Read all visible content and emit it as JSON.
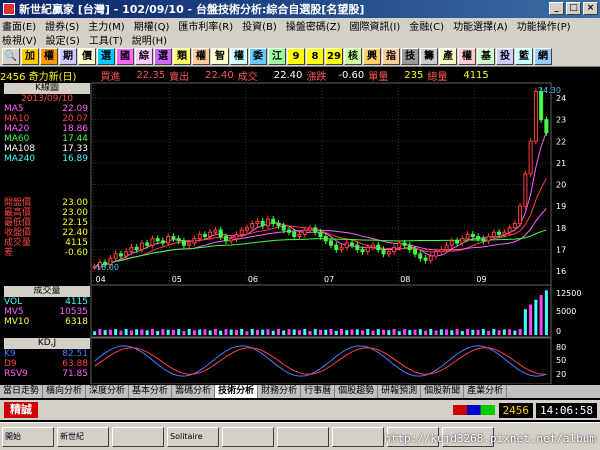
{
  "window": {
    "title": "新世紀贏家 [台灣] - 102/09/10 - 台盤技術分析:綜合自選股[名望股]"
  },
  "menu": {
    "row1": [
      "畫面(E)",
      "證券(S)",
      "主力(M)",
      "期權(Q)",
      "匯市利率(R)",
      "投資(B)",
      "操盤密碼(Z)",
      "國際資訊(I)",
      "金融(C)",
      "功能選擇(A)",
      "功能操作(P)"
    ],
    "row2": [
      "檢視(V)",
      "設定(S)",
      "工具(T)",
      "說明(H)"
    ]
  },
  "toolbar": {
    "buttons": [
      "加",
      "權",
      "期",
      "價",
      "選",
      "國",
      "綜",
      "選",
      "類",
      "權",
      "智",
      "權",
      "委",
      "江",
      "9",
      "8",
      "29",
      "核",
      "興",
      "指",
      "技",
      "籌",
      "產",
      "權",
      "基",
      "投",
      "籃",
      "網"
    ]
  },
  "quote": {
    "code_name": "2456 奇力新(日)",
    "buy_label": "買進",
    "buy": "22.35",
    "sell_label": "賣出",
    "sell": "22.40",
    "deal_label": "成交",
    "deal": "22.40",
    "change_label": "漲跌",
    "change": "-0.60",
    "single_label": "單量",
    "single": "235",
    "total_label": "總量",
    "total": "4115"
  },
  "kpanel": {
    "title": "K線圖",
    "date": "2013/09/10",
    "ma": [
      {
        "name": "MA5",
        "value": "22.09",
        "color": "#ff60ff"
      },
      {
        "name": "MA10",
        "value": "20.07",
        "color": "#ff4040"
      },
      {
        "name": "MA20",
        "value": "18.86",
        "color": "#ff60ff"
      },
      {
        "name": "MA60",
        "value": "17.44",
        "color": "#40ff40"
      },
      {
        "name": "MA108",
        "value": "17.33",
        "color": "#ffffff"
      },
      {
        "name": "MA240",
        "value": "16.89",
        "color": "#40ffff"
      }
    ],
    "prices": [
      {
        "label": "開盤價",
        "value": "23.00"
      },
      {
        "label": "最高價",
        "value": "23.00"
      },
      {
        "label": "最低價",
        "value": "22.15"
      },
      {
        "label": "收盤價",
        "value": "22.40"
      },
      {
        "label": "成交量",
        "value": "4115"
      },
      {
        "label": "差",
        "value": "-0.60"
      }
    ],
    "low_label": "16.00",
    "high_label": "24.30"
  },
  "volume": {
    "title": "成交量",
    "rows": [
      {
        "name": "VOL",
        "value": "4115",
        "color": "#40ffff"
      },
      {
        "name": "MV5",
        "value": "10535",
        "color": "#ff60ff"
      },
      {
        "name": "MV10",
        "value": "6318",
        "color": "#ffff40"
      }
    ],
    "axis": [
      "12500",
      "5000",
      "0"
    ]
  },
  "kd": {
    "title": "KD,J",
    "rows": [
      {
        "name": "K9",
        "value": "82.51",
        "color": "#4080ff"
      },
      {
        "name": "D9",
        "value": "63.88",
        "color": "#ff4040"
      },
      {
        "name": "RSV9",
        "value": "71.85",
        "color": "#ff60ff"
      }
    ],
    "axis": [
      "80",
      "50",
      "20"
    ]
  },
  "tabs": [
    "當日走勢",
    "橫向分析",
    "深度分析",
    "基本分析",
    "籌碼分析",
    "技術分析",
    "財務分析",
    "行事曆",
    "個股趨勢",
    "研報預測",
    "個股新聞",
    "產業分析"
  ],
  "active_tab": "技術分析",
  "status": {
    "left": "精誠",
    "code": "2456",
    "time": "14:06:58"
  },
  "taskbar": [
    "開始",
    "新世紀",
    "",
    "Solitaire",
    "",
    "",
    "",
    "",
    ""
  ],
  "watermark": "http://kujd3268.pixnet.net/album",
  "chart_data": {
    "type": "candlestick",
    "x_labels": [
      "04",
      "05",
      "06",
      "07",
      "08",
      "09"
    ],
    "y_ticks": [
      16,
      17,
      18,
      19,
      20,
      21,
      22,
      23,
      24
    ],
    "ylim": [
      15.5,
      24.6
    ],
    "closes": [
      16.2,
      16.4,
      16.3,
      16.6,
      16.8,
      16.7,
      16.9,
      17.1,
      17.0,
      17.3,
      17.2,
      17.5,
      17.4,
      17.3,
      17.6,
      17.5,
      17.4,
      17.2,
      17.3,
      17.5,
      17.7,
      17.6,
      17.8,
      17.9,
      17.6,
      17.4,
      17.5,
      17.7,
      17.9,
      18.0,
      18.2,
      18.3,
      18.1,
      18.4,
      18.2,
      18.1,
      17.9,
      17.8,
      17.6,
      17.7,
      17.9,
      18.0,
      17.8,
      17.6,
      17.4,
      17.2,
      17.0,
      17.1,
      17.3,
      17.2,
      17.0,
      16.9,
      17.1,
      17.2,
      17.0,
      16.8,
      16.9,
      17.1,
      17.3,
      17.2,
      17.0,
      16.8,
      16.6,
      16.5,
      16.7,
      16.9,
      17.0,
      17.2,
      17.4,
      17.3,
      17.5,
      17.7,
      17.6,
      17.5,
      17.4,
      17.6,
      17.8,
      17.7,
      17.8,
      18.0,
      18.2,
      19.0,
      20.5,
      22.0,
      24.3,
      23.0,
      22.4
    ]
  }
}
